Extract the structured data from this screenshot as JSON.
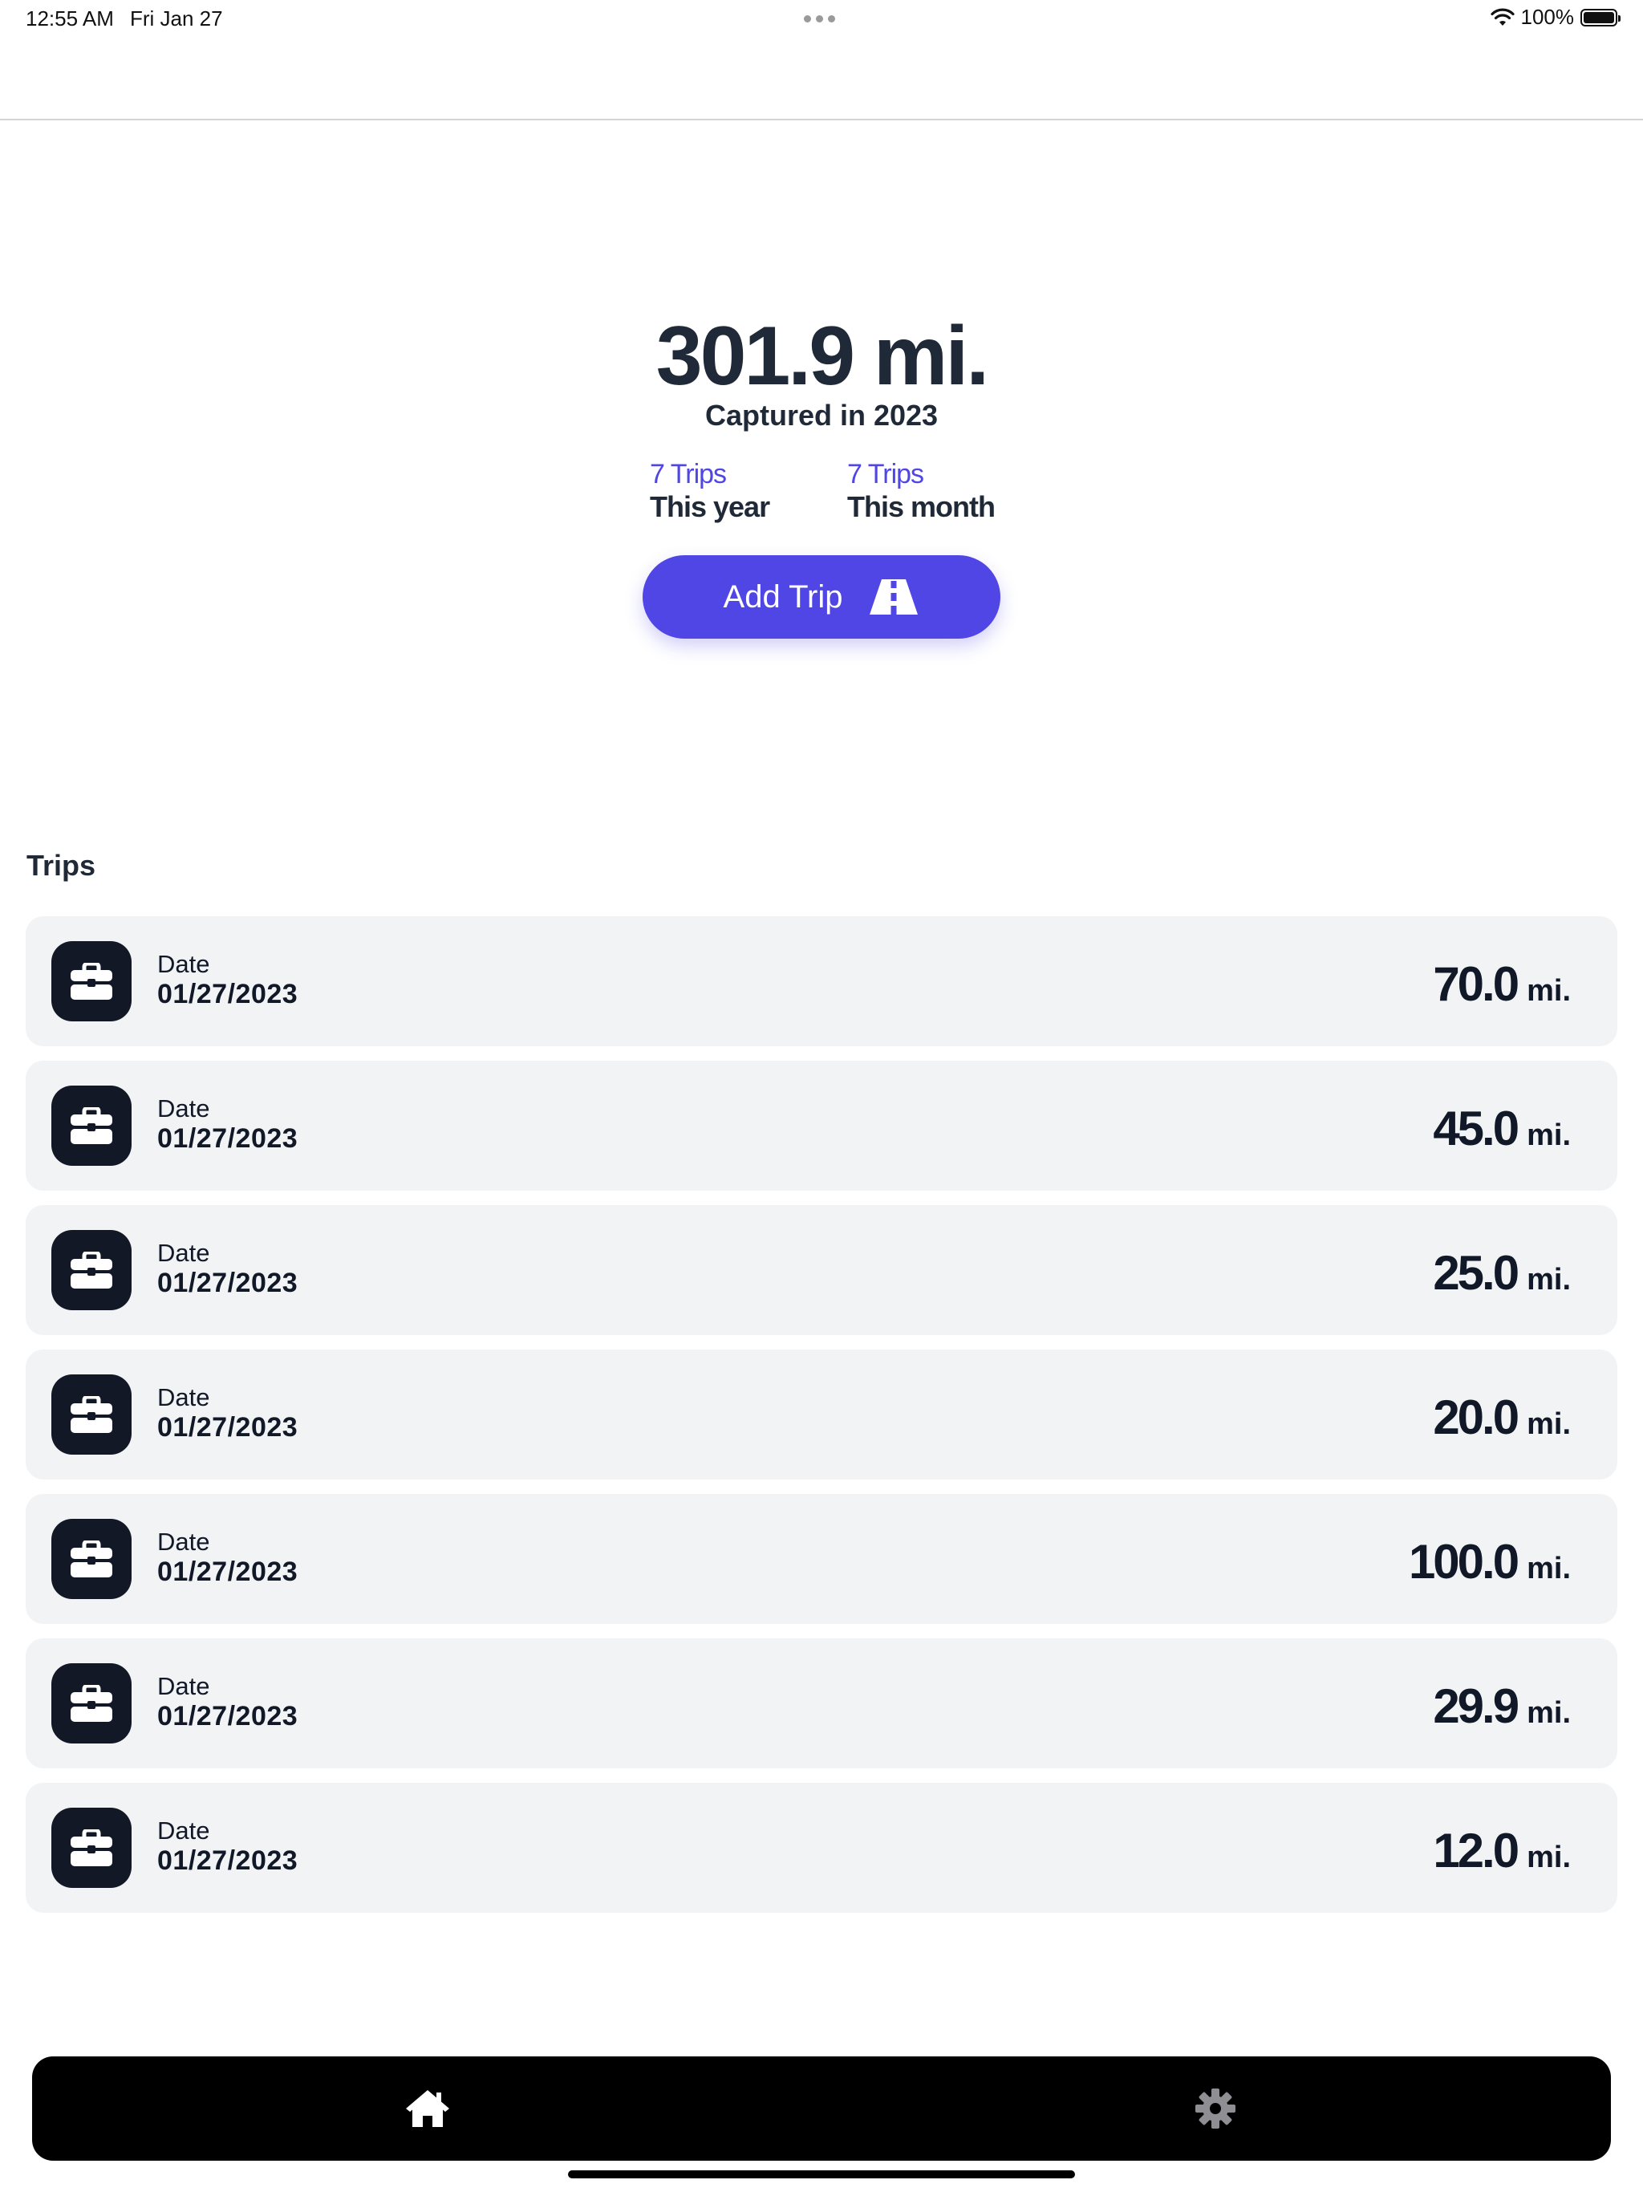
{
  "status_bar": {
    "time": "12:55 AM",
    "date": "Fri Jan 27",
    "battery": "100%",
    "battery_level": 1.0
  },
  "summary": {
    "total_miles": "301.9 mi.",
    "captured_label": "Captured in 2023",
    "stats": [
      {
        "count": "7 Trips",
        "label": "This year"
      },
      {
        "count": "7 Trips",
        "label": "This month"
      }
    ],
    "add_trip_label": "Add Trip"
  },
  "trips": {
    "heading": "Trips",
    "items": [
      {
        "date_caption": "Date",
        "date": "01/27/2023",
        "distance": "70.0",
        "unit": "mi."
      },
      {
        "date_caption": "Date",
        "date": "01/27/2023",
        "distance": "45.0",
        "unit": "mi."
      },
      {
        "date_caption": "Date",
        "date": "01/27/2023",
        "distance": "25.0",
        "unit": "mi."
      },
      {
        "date_caption": "Date",
        "date": "01/27/2023",
        "distance": "20.0",
        "unit": "mi."
      },
      {
        "date_caption": "Date",
        "date": "01/27/2023",
        "distance": "100.0",
        "unit": "mi."
      },
      {
        "date_caption": "Date",
        "date": "01/27/2023",
        "distance": "29.9",
        "unit": "mi."
      },
      {
        "date_caption": "Date",
        "date": "01/27/2023",
        "distance": "12.0",
        "unit": "mi."
      }
    ],
    "icon": "briefcase-icon"
  },
  "tab_bar": {
    "tabs": [
      {
        "icon": "home-icon",
        "active": true
      },
      {
        "icon": "gear-icon",
        "active": false
      }
    ]
  },
  "colors": {
    "accent": "#5046e5",
    "stat_count": "#4f46e5",
    "icon_box": "#121826",
    "row_background": "#f2f3f5",
    "tab_bar": "#000000",
    "inactive_tab_icon": "#8e8e93"
  }
}
